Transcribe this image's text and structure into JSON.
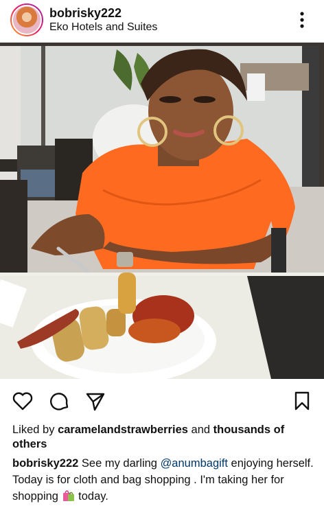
{
  "post": {
    "username": "bobrisky222",
    "location": "Eko Hotels and Suites"
  },
  "icons": {
    "more": "more-vertical-icon",
    "like": "heart-icon",
    "comment": "comment-icon",
    "share": "send-icon",
    "save": "bookmark-icon",
    "shopping": "shopping-bags-icon"
  },
  "likes": {
    "prefix": "Liked by",
    "user": "caramelandstrawberries",
    "middle": "and",
    "rest": "thousands of others"
  },
  "caption": {
    "username": "bobrisky222",
    "text_before": "See my darling",
    "mention": "@anumbagift",
    "text_after": "enjoying herself.  Today is for cloth and bag shopping . I'm taking her for shopping",
    "text_end": "today."
  },
  "colors": {
    "mention": "#00376b",
    "text": "#111111"
  }
}
